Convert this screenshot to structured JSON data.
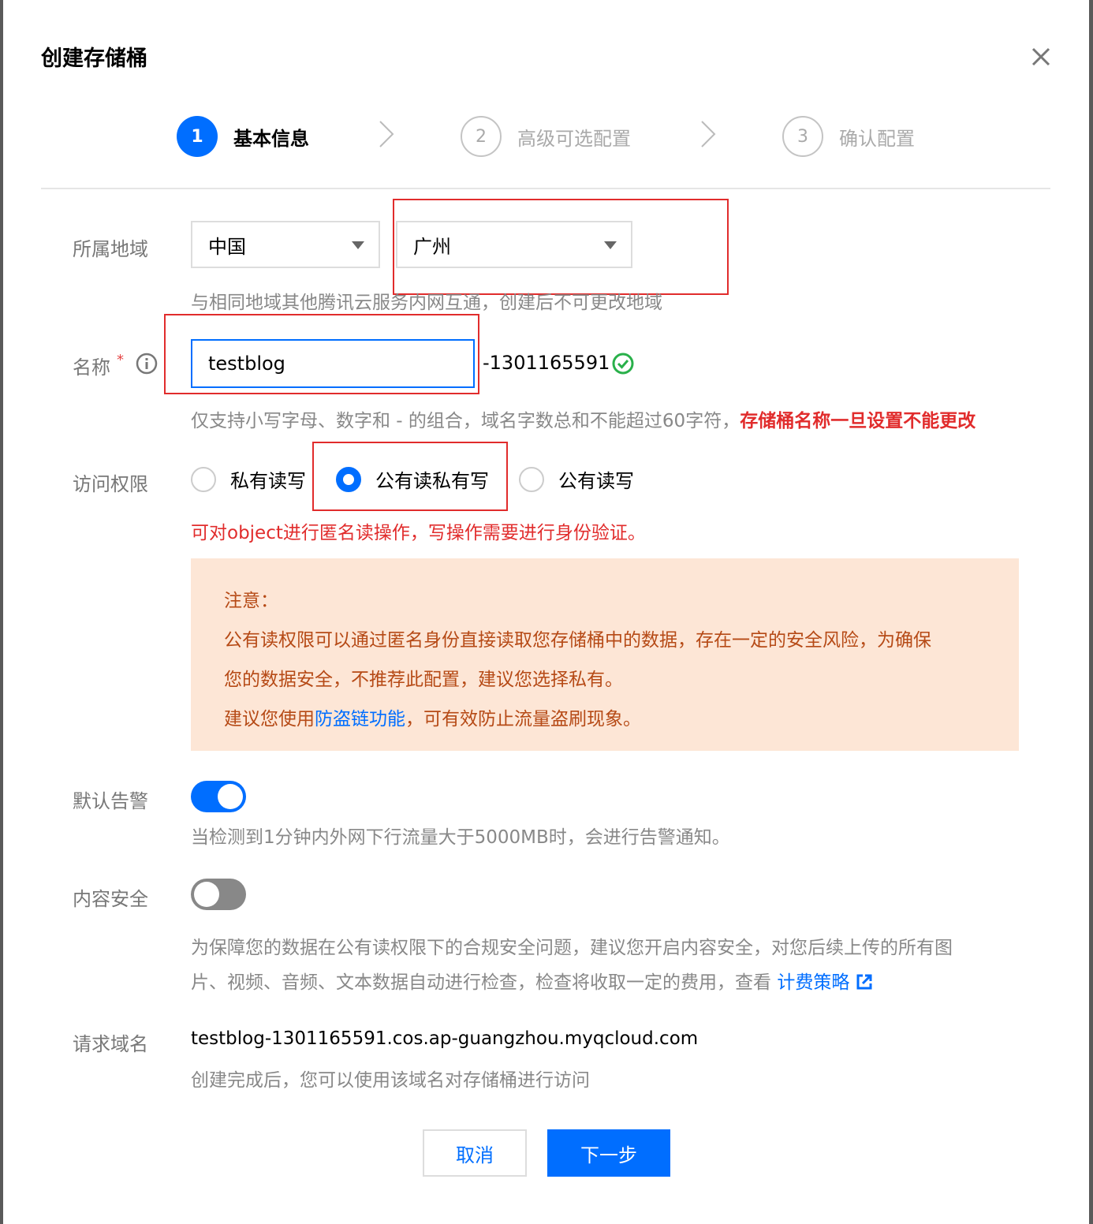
{
  "dialog": {
    "title": "创建存储桶"
  },
  "steps": [
    {
      "num": "1",
      "label": "基本信息"
    },
    {
      "num": "2",
      "label": "高级可选配置"
    },
    {
      "num": "3",
      "label": "确认配置"
    }
  ],
  "region": {
    "label": "所属地域",
    "country": "中国",
    "city": "广州",
    "hint": "与相同地域其他腾讯云服务内网互通，创建后不可更改地域"
  },
  "name": {
    "label": "名称",
    "required_mark": "*",
    "value": "testblog",
    "suffix": "-1301165591",
    "hint": "仅支持小写字母、数字和 - 的组合，域名字数总和不能超过60字符，",
    "hint_warning": "存储桶名称一旦设置不能更改"
  },
  "access": {
    "label": "访问权限",
    "options": [
      "私有读写",
      "公有读私有写",
      "公有读写"
    ],
    "selected": "公有读私有写",
    "description": "可对object进行匿名读操作，写操作需要进行身份验证。"
  },
  "notice": {
    "title": "注意：",
    "line1": "公有读权限可以通过匿名身份直接读取您存储桶中的数据，存在一定的安全风险，为确保",
    "line2": "您的数据安全，不推荐此配置，建议您选择私有。",
    "line3_pre": "建议您使用",
    "line3_link": "防盗链功能",
    "line3_post": "，可有效防止流量盗刷现象。"
  },
  "alarm": {
    "label": "默认告警",
    "enabled": true,
    "hint": "当检测到1分钟内外网下行流量大于5000MB时，会进行告警通知。"
  },
  "content_security": {
    "label": "内容安全",
    "enabled": false,
    "hint1": "为保障您的数据在公有读权限下的合规安全问题，建议您开启内容安全，对您后续上传的所有图",
    "hint2": "片、视频、音频、文本数据自动进行检查，检查将收取一定的费用，查看",
    "link": "计费策略"
  },
  "request_domain": {
    "label": "请求域名",
    "value": "testblog-1301165591.cos.ap-guangzhou.myqcloud.com",
    "hint": "创建完成后，您可以使用该域名对存储桶进行访问"
  },
  "buttons": {
    "cancel": "取消",
    "next": "下一步"
  },
  "colors": {
    "primary": "#006eff",
    "warning": "#e12c2c",
    "notice_bg": "#fde6d6",
    "success": "#29b04a"
  }
}
